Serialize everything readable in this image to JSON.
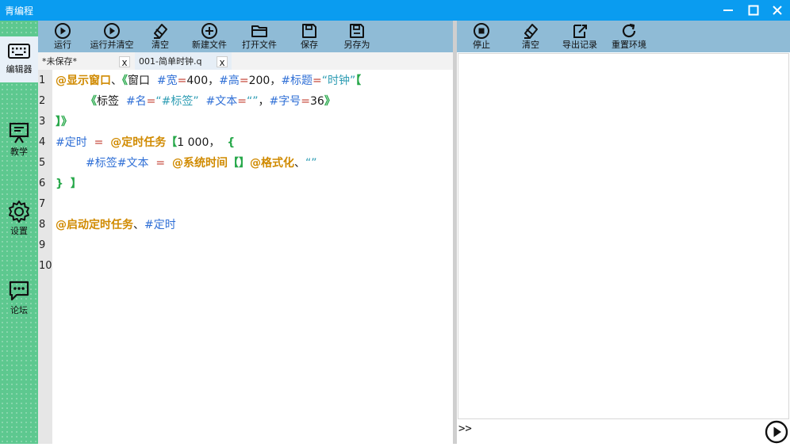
{
  "app": {
    "title": "青编程"
  },
  "window": {
    "minimize_icon": "minimize-icon",
    "maximize_icon": "maximize-icon",
    "close_icon": "close-icon"
  },
  "sidebar": {
    "items": [
      {
        "label": "编辑器",
        "icon": "keyboard-icon",
        "active": true
      },
      {
        "label": "教学",
        "icon": "teacher-board-icon",
        "active": false
      },
      {
        "label": "设置",
        "icon": "gear-icon",
        "active": false
      },
      {
        "label": "论坛",
        "icon": "chat-bubble-icon",
        "active": false
      }
    ]
  },
  "editor_toolbar": {
    "buttons": [
      {
        "label": "运行",
        "icon": "play-icon"
      },
      {
        "label": "运行并清空",
        "icon": "play-icon"
      },
      {
        "label": "清空",
        "icon": "eraser-icon"
      },
      {
        "label": "新建文件",
        "icon": "plus-circle-icon"
      },
      {
        "label": "打开文件",
        "icon": "folder-icon"
      },
      {
        "label": "保存",
        "icon": "save-icon"
      },
      {
        "label": "另存为",
        "icon": "save-as-icon"
      }
    ]
  },
  "tabs": [
    {
      "label": "*未保存*",
      "close": "x"
    },
    {
      "label": "001-简单时钟.q",
      "close": "x"
    }
  ],
  "editor": {
    "line_numbers": [
      "1",
      "2",
      "3",
      "4",
      "5",
      "6",
      "7",
      "8",
      "9",
      "10"
    ],
    "lines": [
      "@显示窗口、《窗口  #宽=400，#高=200，#标题=“时钟”【",
      "《标签  #名=“#标签”  #文本=“”，#字号=36》",
      "】》",
      "#定时  =  @定时任务【1 000，  {",
      "#标签#文本  =  @系统时间【】@格式化、“”",
      "}  】",
      "",
      "@启动定时任务、#定时",
      "",
      ""
    ]
  },
  "console_toolbar": {
    "buttons": [
      {
        "label": "停止",
        "icon": "stop-icon"
      },
      {
        "label": "清空",
        "icon": "eraser-icon"
      },
      {
        "label": "导出记录",
        "icon": "export-icon"
      },
      {
        "label": "重置环境",
        "icon": "refresh-icon"
      }
    ]
  },
  "console": {
    "prompt": ">>",
    "input_value": "",
    "send_icon": "run-circle-icon"
  },
  "colors": {
    "titlebar": "#0a9cf0",
    "sidebar": "#5dc88f",
    "toolbar": "#8fbbd6",
    "keyword_at": "#d08a00",
    "keyword_hash": "#2f6fd6",
    "bracket": "#27a84a"
  }
}
